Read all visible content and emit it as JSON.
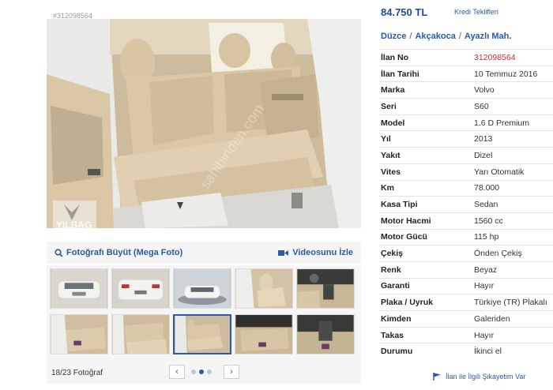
{
  "gallery": {
    "id_tag": "#312098564",
    "watermark": "sahibinden.com",
    "dealer_logo": "YILBAG",
    "enlarge_label": "Fotoğrafı Büyüt (Mega Foto)",
    "video_label": "Videosunu İzle",
    "photo_count": "18/23 Fotoğraf",
    "prev_icon": "‹",
    "next_icon": "›",
    "dots": 3,
    "active_dot": 2,
    "accent_color": "#2b5aa6"
  },
  "listing": {
    "price": "84.750 TL",
    "credit_link": "Kredi Teklifleri",
    "location": [
      "Düzce",
      "Akçakoca",
      "Ayazlı Mah."
    ],
    "location_separator": "/",
    "details": [
      {
        "key": "İlan No",
        "value": "312098564",
        "highlight": true
      },
      {
        "key": "İlan Tarihi",
        "value": "10 Temmuz 2016"
      },
      {
        "key": "Marka",
        "value": "Volvo"
      },
      {
        "key": "Seri",
        "value": "S60"
      },
      {
        "key": "Model",
        "value": "1.6 D Premium"
      },
      {
        "key": "Yıl",
        "value": "2013"
      },
      {
        "key": "Yakıt",
        "value": "Dizel"
      },
      {
        "key": "Vites",
        "value": "Yarı Otomatik"
      },
      {
        "key": "Km",
        "value": "78.000"
      },
      {
        "key": "Kasa Tipi",
        "value": "Sedan"
      },
      {
        "key": "Motor Hacmi",
        "value": "1560 cc"
      },
      {
        "key": "Motor Gücü",
        "value": "115 hp"
      },
      {
        "key": "Çekiş",
        "value": "Önden Çekiş"
      },
      {
        "key": "Renk",
        "value": "Beyaz"
      },
      {
        "key": "Garanti",
        "value": "Hayır"
      },
      {
        "key": "Plaka / Uyruk",
        "value": "Türkiye (TR) Plakalı"
      },
      {
        "key": "Kimden",
        "value": "Galeriden"
      },
      {
        "key": "Takas",
        "value": "Hayır"
      },
      {
        "key": "Durumu",
        "value": "İkinci el"
      }
    ],
    "complaint_link": "İlan ile İlgili Şikayetim Var"
  }
}
